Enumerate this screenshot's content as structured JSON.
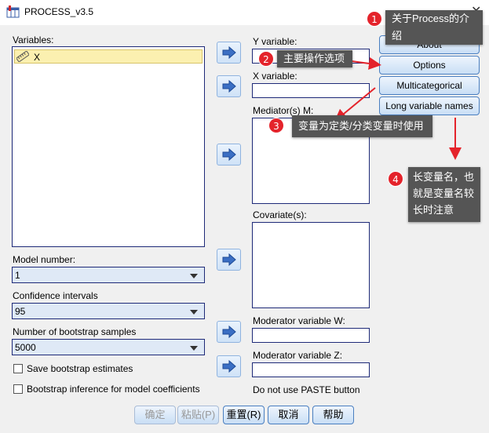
{
  "window": {
    "title": "PROCESS_v3.5"
  },
  "left": {
    "variables_label": "Variables:",
    "variables": [
      "X"
    ],
    "model_number_label": "Model number:",
    "model_number": "1",
    "ci_label": "Confidence intervals",
    "ci_value": "95",
    "bootstrap_label": "Number of bootstrap samples",
    "bootstrap_value": "5000",
    "save_bootstrap": "Save bootstrap estimates",
    "bootstrap_inference": "Bootstrap inference for model coefficients"
  },
  "middle": {
    "y_label": "Y variable:",
    "x_label": "X variable:",
    "mediators_label": "Mediator(s) M:",
    "covariates_label": "Covariate(s):",
    "mod_w_label": "Moderator variable W:",
    "mod_z_label": "Moderator variable Z:",
    "paste_note": "Do not use PASTE button"
  },
  "right_buttons": {
    "about": "About",
    "options": "Options",
    "multicategorical": "Multicategorical",
    "long_names": "Long variable names"
  },
  "bottom_buttons": {
    "ok": "确定",
    "paste": "粘贴(P)",
    "reset": "重置(R)",
    "cancel": "取消",
    "help": "帮助"
  },
  "callouts": {
    "c1": {
      "num": "1",
      "text": "关于Process的介绍"
    },
    "c2": {
      "num": "2",
      "text": "主要操作选项"
    },
    "c3": {
      "num": "3",
      "text": "变量为定类/分类变量时使用"
    },
    "c4": {
      "num": "4",
      "line1": "长变量名，也",
      "line2": "就是变量名较",
      "line3": "长时注意"
    }
  },
  "colors": {
    "accent_red": "#e4232b",
    "callout_bg": "#555555",
    "field_border": "#1e2a78"
  }
}
